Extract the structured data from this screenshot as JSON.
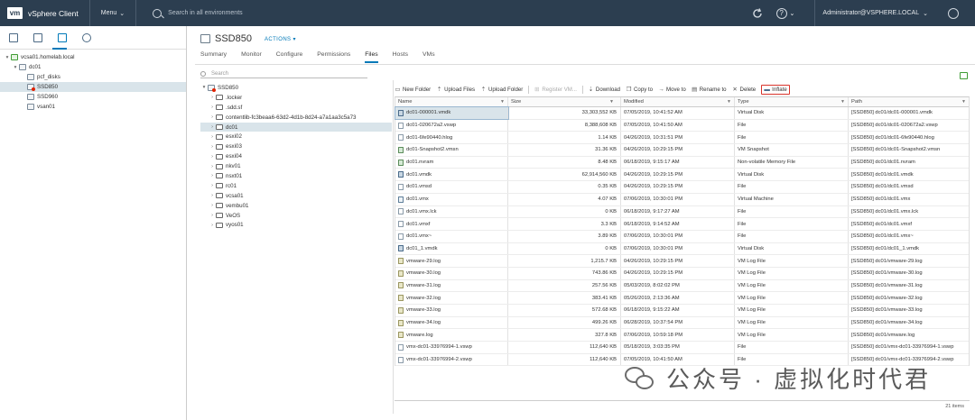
{
  "header": {
    "logo": "vm",
    "app_name": "vSphere Client",
    "menu_label": "Menu",
    "search_placeholder": "Search in all environments",
    "user": "Administrator@VSPHERE.LOCAL",
    "help_label": "?"
  },
  "inventory": {
    "items": [
      {
        "label": "vcsa01.homelab.local",
        "level": 0,
        "caret": "▾",
        "kind": "vc"
      },
      {
        "label": "dc01",
        "level": 1,
        "caret": "▾",
        "kind": "dc"
      },
      {
        "label": "pcf_disks",
        "level": 2,
        "caret": "",
        "kind": "ds"
      },
      {
        "label": "SSD850",
        "level": 2,
        "caret": "",
        "kind": "ds-red",
        "selected": true
      },
      {
        "label": "SSD960",
        "level": 2,
        "caret": "",
        "kind": "ds"
      },
      {
        "label": "vsan01",
        "level": 2,
        "caret": "",
        "kind": "ds"
      }
    ]
  },
  "object": {
    "title": "SSD850",
    "actions_label": "ACTIONS ▾",
    "tabs": [
      "Summary",
      "Monitor",
      "Configure",
      "Permissions",
      "Files",
      "Hosts",
      "VMs"
    ],
    "active_tab": "Files"
  },
  "files_tree": {
    "search_placeholder": "Search",
    "root": "SSD850",
    "folders": [
      ".locker",
      ".sdd.sf",
      "contentlib-fc3beaa6-63d2-4d1b-8d24-a7a1aa3c5a73",
      "dc01",
      "esxi02",
      "esxi03",
      "esxi04",
      "nkv01",
      "nsxt01",
      "rc01",
      "vcsa01",
      "vembu01",
      "VeOS",
      "vyos01"
    ],
    "selected": "dc01"
  },
  "toolbar": {
    "new_folder": "New Folder",
    "upload_files": "Upload Files",
    "upload_folder": "Upload Folder",
    "register_vm": "Register VM...",
    "download": "Download",
    "copy_to": "Copy to",
    "move_to": "Move to",
    "rename_to": "Rename to",
    "delete": "Delete",
    "inflate": "Inflate"
  },
  "grid": {
    "columns": [
      "Name",
      "Size",
      "Modified",
      "Type",
      "Path"
    ],
    "rows": [
      {
        "name": "dc01-000001.vmdk",
        "size": "33,303,552 KB",
        "modified": "07/05/2019, 10:41:52 AM",
        "type": "Virtual Disk",
        "path": "[SSD850] dc01/dc01-000001.vmdk",
        "icon": "vdisk",
        "selected": true
      },
      {
        "name": "dc01-020672a2.vswp",
        "size": "8,388,608 KB",
        "modified": "07/05/2019, 10:41:50 AM",
        "type": "File",
        "path": "[SSD850] dc01/dc01-020672a2.vswp",
        "icon": "file"
      },
      {
        "name": "dc01-6fe90440.hlog",
        "size": "1.14 KB",
        "modified": "04/26/2019, 10:31:51 PM",
        "type": "File",
        "path": "[SSD850] dc01/dc01-6fe90440.hlog",
        "icon": "file"
      },
      {
        "name": "dc01-Snapshot2.vmsn",
        "size": "31.36 KB",
        "modified": "04/26/2019, 10:29:15 PM",
        "type": "VM Snapshot",
        "path": "[SSD850] dc01/dc01-Snapshot2.vmsn",
        "icon": "snap"
      },
      {
        "name": "dc01.nvram",
        "size": "8.48 KB",
        "modified": "06/18/2019, 9:15:17 AM",
        "type": "Non-volatile Memory File",
        "path": "[SSD850] dc01/dc01.nvram",
        "icon": "snap"
      },
      {
        "name": "dc01.vmdk",
        "size": "62,914,560 KB",
        "modified": "04/26/2019, 10:29:15 PM",
        "type": "Virtual Disk",
        "path": "[SSD850] dc01/dc01.vmdk",
        "icon": "vdisk"
      },
      {
        "name": "dc01.vmsd",
        "size": "0.35 KB",
        "modified": "04/26/2019, 10:29:15 PM",
        "type": "File",
        "path": "[SSD850] dc01/dc01.vmsd",
        "icon": "file"
      },
      {
        "name": "dc01.vmx",
        "size": "4.07 KB",
        "modified": "07/06/2019, 10:30:01 PM",
        "type": "Virtual Machine",
        "path": "[SSD850] dc01/dc01.vmx",
        "icon": "vm"
      },
      {
        "name": "dc01.vmx.lck",
        "size": "0 KB",
        "modified": "06/18/2019, 9:17:27 AM",
        "type": "File",
        "path": "[SSD850] dc01/dc01.vmx.lck",
        "icon": "file"
      },
      {
        "name": "dc01.vmxf",
        "size": "3.3 KB",
        "modified": "06/18/2019, 9:14:52 AM",
        "type": "File",
        "path": "[SSD850] dc01/dc01.vmxf",
        "icon": "file"
      },
      {
        "name": "dc01.vmx~",
        "size": "3.89 KB",
        "modified": "07/06/2019, 10:30:01 PM",
        "type": "File",
        "path": "[SSD850] dc01/dc01.vmx~",
        "icon": "file"
      },
      {
        "name": "dc01_1.vmdk",
        "size": "0 KB",
        "modified": "07/06/2019, 10:30:01 PM",
        "type": "Virtual Disk",
        "path": "[SSD850] dc01/dc01_1.vmdk",
        "icon": "vdisk"
      },
      {
        "name": "vmware-29.log",
        "size": "1,215.7 KB",
        "modified": "04/26/2019, 10:29:15 PM",
        "type": "VM Log File",
        "path": "[SSD850] dc01/vmware-29.log",
        "icon": "log"
      },
      {
        "name": "vmware-30.log",
        "size": "743.86 KB",
        "modified": "04/26/2019, 10:29:15 PM",
        "type": "VM Log File",
        "path": "[SSD850] dc01/vmware-30.log",
        "icon": "log"
      },
      {
        "name": "vmware-31.log",
        "size": "257.56 KB",
        "modified": "05/03/2019, 8:02:02 PM",
        "type": "VM Log File",
        "path": "[SSD850] dc01/vmware-31.log",
        "icon": "log"
      },
      {
        "name": "vmware-32.log",
        "size": "383.41 KB",
        "modified": "05/26/2019, 2:13:36 AM",
        "type": "VM Log File",
        "path": "[SSD850] dc01/vmware-32.log",
        "icon": "log"
      },
      {
        "name": "vmware-33.log",
        "size": "572.68 KB",
        "modified": "06/18/2019, 9:15:22 AM",
        "type": "VM Log File",
        "path": "[SSD850] dc01/vmware-33.log",
        "icon": "log"
      },
      {
        "name": "vmware-34.log",
        "size": "499.26 KB",
        "modified": "06/28/2019, 10:37:54 PM",
        "type": "VM Log File",
        "path": "[SSD850] dc01/vmware-34.log",
        "icon": "log"
      },
      {
        "name": "vmware.log",
        "size": "327.8 KB",
        "modified": "07/06/2019, 10:59:18 PM",
        "type": "VM Log File",
        "path": "[SSD850] dc01/vmware.log",
        "icon": "log"
      },
      {
        "name": "vmx-dc01-33976994-1.vswp",
        "size": "112,640 KB",
        "modified": "05/18/2019, 3:03:35 PM",
        "type": "File",
        "path": "[SSD850] dc01/vmx-dc01-33976994-1.vswp",
        "icon": "file"
      },
      {
        "name": "vmx-dc01-33976994-2.vswp",
        "size": "112,640 KB",
        "modified": "07/05/2019, 10:41:50 AM",
        "type": "File",
        "path": "[SSD850] dc01/vmx-dc01-33976994-2.vswp",
        "icon": "file"
      }
    ],
    "footer": "21 items"
  },
  "watermark": {
    "text": "公众号 · 虚拟化时代君"
  }
}
